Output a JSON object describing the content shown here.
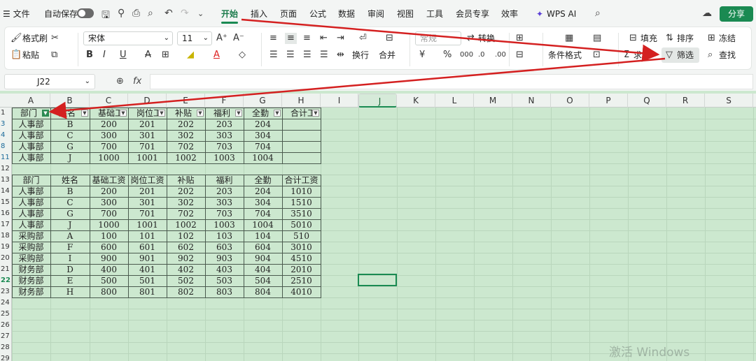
{
  "menubar": {
    "hamburger": "☰ 文件",
    "autosave": "自动保存",
    "tabs": [
      "开始",
      "插入",
      "页面",
      "公式",
      "数据",
      "审阅",
      "视图",
      "工具",
      "会员专享",
      "效率"
    ],
    "wps_ai": "WPS AI",
    "share": "分享"
  },
  "ribbon": {
    "format_brush": "格式刷",
    "paste": "粘贴",
    "font_name": "宋体",
    "font_size": "11",
    "number_format": "常规",
    "convert": "转换",
    "wrap": "换行",
    "merge": "合并",
    "cond_format": "条件格式",
    "sum": "求和",
    "fill": "填充",
    "sort": "排序",
    "freeze": "冻结",
    "filter": "筛选",
    "find": "查找"
  },
  "formula_bar": {
    "cell_ref": "J22",
    "fx": "fx",
    "value": ""
  },
  "sheet": {
    "columns": [
      "A",
      "B",
      "C",
      "D",
      "E",
      "F",
      "G",
      "H",
      "I",
      "J",
      "K",
      "L",
      "M",
      "N",
      "O",
      "P",
      "Q",
      "R",
      "S"
    ],
    "rows": [
      "1",
      "3",
      "4",
      "8",
      "11",
      "12",
      "13",
      "14",
      "15",
      "16",
      "17",
      "18",
      "19",
      "20",
      "21",
      "22",
      "23",
      "24",
      "25",
      "26",
      "27",
      "28",
      "29"
    ],
    "filtered_headers": [
      "部门",
      "姓名",
      "基础工",
      "岗位工",
      "补贴",
      "福利",
      "全勤",
      "合计工"
    ],
    "filtered_rows": [
      [
        "人事部",
        "B",
        "200",
        "201",
        "202",
        "203",
        "204",
        ""
      ],
      [
        "人事部",
        "C",
        "300",
        "301",
        "302",
        "303",
        "304",
        ""
      ],
      [
        "人事部",
        "G",
        "700",
        "701",
        "702",
        "703",
        "704",
        ""
      ],
      [
        "人事部",
        "J",
        "1000",
        "1001",
        "1002",
        "1003",
        "1004",
        ""
      ]
    ],
    "table_headers": [
      "部门",
      "姓名",
      "基础工资",
      "岗位工资",
      "补贴",
      "福利",
      "全勤",
      "合计工资"
    ],
    "table_rows": [
      [
        "人事部",
        "B",
        "200",
        "201",
        "202",
        "203",
        "204",
        "1010"
      ],
      [
        "人事部",
        "C",
        "300",
        "301",
        "302",
        "303",
        "304",
        "1510"
      ],
      [
        "人事部",
        "G",
        "700",
        "701",
        "702",
        "703",
        "704",
        "3510"
      ],
      [
        "人事部",
        "J",
        "1000",
        "1001",
        "1002",
        "1003",
        "1004",
        "5010"
      ],
      [
        "采购部",
        "A",
        "100",
        "101",
        "102",
        "103",
        "104",
        "510"
      ],
      [
        "采购部",
        "F",
        "600",
        "601",
        "602",
        "603",
        "604",
        "3010"
      ],
      [
        "采购部",
        "I",
        "900",
        "901",
        "902",
        "903",
        "904",
        "4510"
      ],
      [
        "财务部",
        "D",
        "400",
        "401",
        "402",
        "403",
        "404",
        "2010"
      ],
      [
        "财务部",
        "E",
        "500",
        "501",
        "502",
        "503",
        "504",
        "2510"
      ],
      [
        "财务部",
        "H",
        "800",
        "801",
        "802",
        "803",
        "804",
        "4010"
      ]
    ]
  },
  "watermark": "激活 Windows",
  "colors": {
    "accent": "#1a8a52",
    "sheet_bg": "#cce8cf",
    "arrow": "#d42020"
  }
}
